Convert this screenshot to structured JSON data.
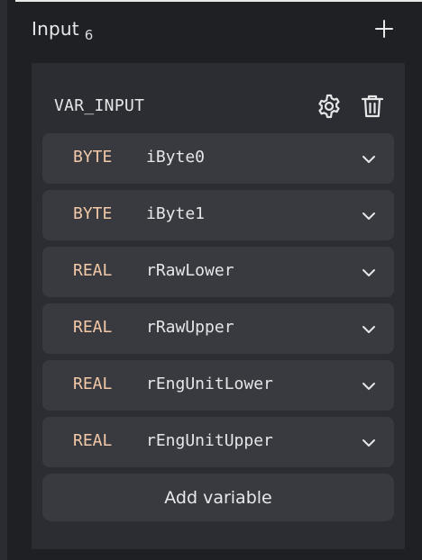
{
  "panel": {
    "title": "Input",
    "count": "6",
    "add_icon": "plus-icon"
  },
  "block": {
    "title": "VAR_INPUT",
    "settings_icon": "gear-icon",
    "delete_icon": "trash-icon",
    "variables": [
      {
        "type": "BYTE",
        "name": "iByte0"
      },
      {
        "type": "BYTE",
        "name": "iByte1"
      },
      {
        "type": "REAL",
        "name": "rRawLower"
      },
      {
        "type": "REAL",
        "name": "rRawUpper"
      },
      {
        "type": "REAL",
        "name": "rEngUnitLower"
      },
      {
        "type": "REAL",
        "name": "rEngUnitUpper"
      }
    ],
    "add_label": "Add variable"
  },
  "colors": {
    "background": "#1e2024",
    "card": "#2b2d32",
    "row": "#383a40",
    "type_text": "#f3c9a8",
    "text": "#e6e6e8"
  }
}
